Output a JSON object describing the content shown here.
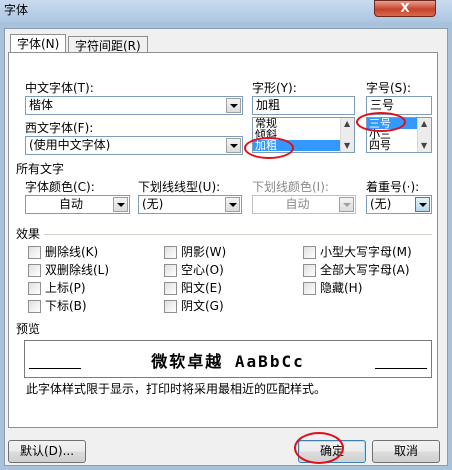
{
  "window": {
    "title": "字体",
    "close_label": "X"
  },
  "tabs": [
    {
      "label": "字体(N)",
      "active": true
    },
    {
      "label": "字符间距(R)",
      "active": false
    }
  ],
  "font": {
    "chinese_font_label": "中文字体(T):",
    "chinese_font_value": "楷体",
    "western_font_label": "西文字体(F):",
    "western_font_value": "(使用中文字体)",
    "style_label": "字形(Y):",
    "style_value": "加粗",
    "style_options": [
      "常规",
      "倾斜",
      "加粗"
    ],
    "style_selected": "加粗",
    "size_label": "字号(S):",
    "size_value": "三号",
    "size_options": [
      "三号",
      "小三",
      "四号"
    ],
    "size_selected": "三号"
  },
  "all_text": {
    "section_label": "所有文字",
    "font_color_label": "字体颜色(C):",
    "font_color_value": "自动",
    "underline_type_label": "下划线线型(U):",
    "underline_type_value": "(无)",
    "underline_color_label": "下划线颜色(I):",
    "underline_color_value": "自动",
    "emphasis_label": "着重号(·):",
    "emphasis_value": "(无)"
  },
  "effects": {
    "section_label": "效果",
    "col1": [
      "删除线(K)",
      "双删除线(L)",
      "上标(P)",
      "下标(B)"
    ],
    "col2": [
      "阴影(W)",
      "空心(O)",
      "阳文(E)",
      "阴文(G)"
    ],
    "col3": [
      "小型大写字母(M)",
      "全部大写字母(A)",
      "隐藏(H)"
    ]
  },
  "preview": {
    "section_label": "预览",
    "sample_text": "微软卓越 AaBbCc",
    "note": "此字体样式限于显示，打印时将采用最相近的匹配样式。"
  },
  "buttons": {
    "default_label": "默认(D)...",
    "ok_label": "确定",
    "cancel_label": "取消"
  },
  "colors": {
    "annotation_ring": "#e0101a",
    "selection": "#3399ff"
  }
}
